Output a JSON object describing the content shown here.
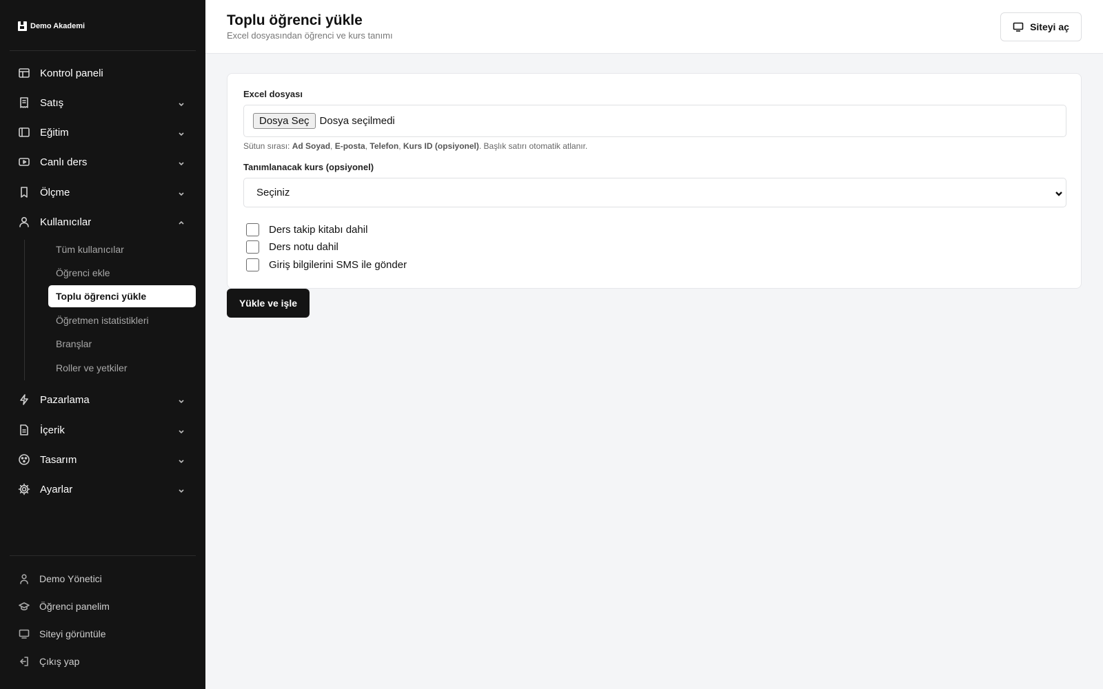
{
  "brand": {
    "name": "Demo Akademi"
  },
  "sidebar": {
    "items": [
      {
        "label": "Kontrol paneli",
        "icon": "layout-icon"
      },
      {
        "label": "Satış",
        "icon": "receipt-icon"
      },
      {
        "label": "Eğitim",
        "icon": "book-icon"
      },
      {
        "label": "Canlı ders",
        "icon": "video-icon"
      },
      {
        "label": "Ölçme",
        "icon": "bookmark-icon"
      },
      {
        "label": "Kullanıcılar",
        "icon": "user-icon"
      },
      {
        "label": "Pazarlama",
        "icon": "zap-icon"
      },
      {
        "label": "İçerik",
        "icon": "file-icon"
      },
      {
        "label": "Tasarım",
        "icon": "palette-icon"
      },
      {
        "label": "Ayarlar",
        "icon": "gear-icon"
      }
    ],
    "sub_items": [
      "Tüm kullanıcılar",
      "Öğrenci ekle",
      "Toplu öğrenci yükle",
      "Öğretmen istatistikleri",
      "Branşlar",
      "Roller ve yetkiler"
    ],
    "footer": [
      {
        "label": "Demo Yönetici",
        "icon": "user-icon"
      },
      {
        "label": "Öğrenci panelim",
        "icon": "graduation-cap-icon"
      },
      {
        "label": "Siteyi görüntüle",
        "icon": "monitor-icon"
      },
      {
        "label": "Çıkış yap",
        "icon": "logout-icon"
      }
    ]
  },
  "header": {
    "title": "Toplu öğrenci yükle",
    "subtitle": "Excel dosyasından öğrenci ve kurs tanımı",
    "site_button": "Siteyi aç"
  },
  "form": {
    "file_label": "Excel dosyası",
    "file_button": "Dosya Seç",
    "file_status": "Dosya seçilmedi",
    "hint_prefix": "Sütun sırası: ",
    "hint_cols": [
      "Ad Soyad",
      "E-posta",
      "Telefon",
      "Kurs ID (opsiyonel)"
    ],
    "hint_suffix": ". Başlık satırı otomatik atlanır.",
    "course_label": "Tanımlanacak kurs (opsiyonel)",
    "course_value": "Seçiniz",
    "checkboxes": [
      "Ders takip kitabı dahil",
      "Ders notu dahil",
      "Giriş bilgilerini SMS ile gönder"
    ],
    "submit": "Yükle ve işle"
  }
}
